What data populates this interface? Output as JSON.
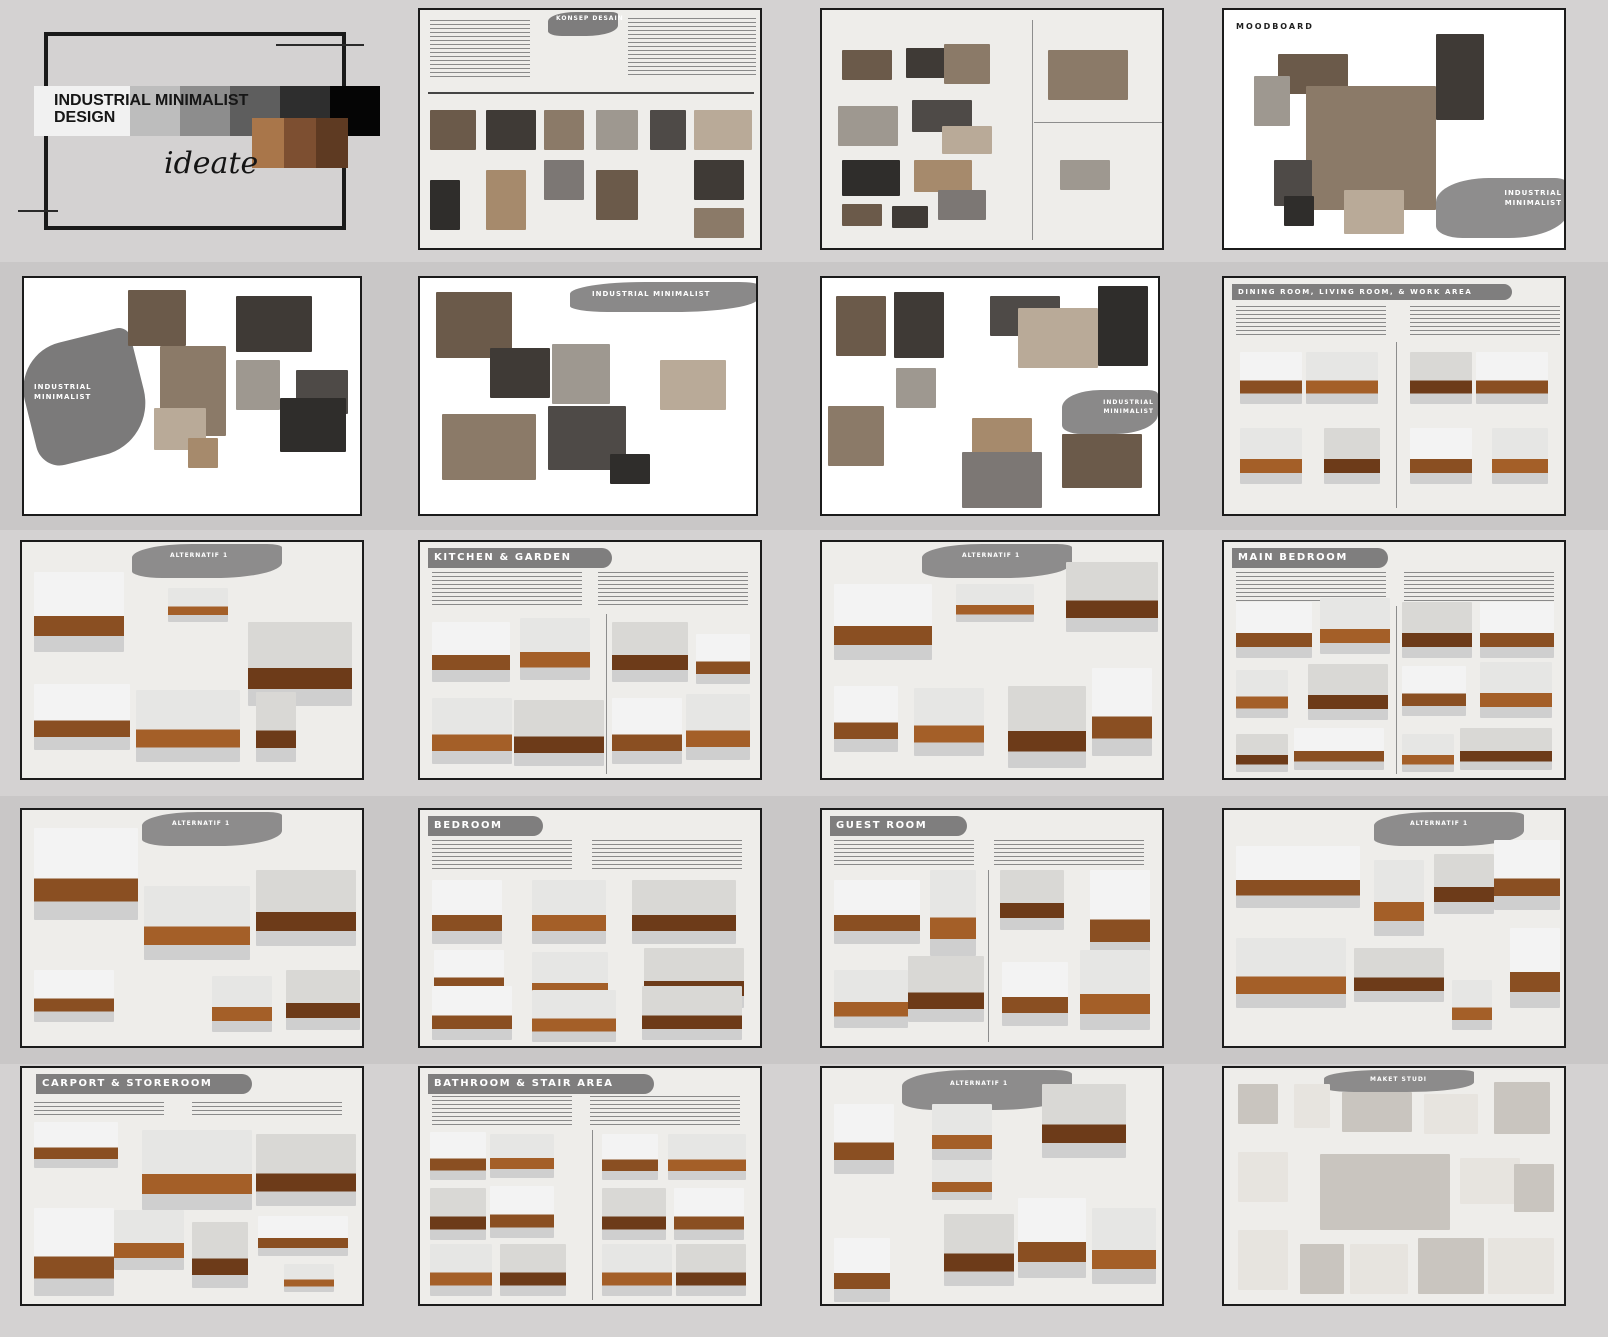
{
  "cover": {
    "title_line1": "INDUSTRIAL MINIMALIST",
    "title_line2": "DESIGN",
    "script_word": "ideate",
    "swatch_colors": [
      "#f1f1f1",
      "#bdbdbd",
      "#8d8d8d",
      "#5e5e5e",
      "#2e2e2e",
      "#050505"
    ],
    "wood_colors": [
      "#a9764a",
      "#7d4f31",
      "#5e3a22"
    ]
  },
  "slides": [
    {
      "id": "concept",
      "text": "KONSEP DESAIN"
    },
    {
      "id": "references",
      "text": ""
    },
    {
      "id": "moodboard",
      "text": "MOODBOARD",
      "label": "INDUSTRIAL MINIMALIST"
    },
    {
      "id": "im-board-1",
      "label": "INDUSTRIAL MINIMALIST"
    },
    {
      "id": "im-board-2",
      "label": "INDUSTRIAL MINIMALIST"
    },
    {
      "id": "im-board-3",
      "label": "INDUSTRIAL MINIMALIST"
    },
    {
      "id": "dining",
      "header": "DINING ROOM, LIVING ROOM, & WORK AREA"
    },
    {
      "id": "alt-living",
      "text": "ALTERNATIF 1"
    },
    {
      "id": "kitchen",
      "header": "KITCHEN & GARDEN"
    },
    {
      "id": "alt-kitchen",
      "text": "ALTERNATIF 1"
    },
    {
      "id": "main-bedroom",
      "header": "MAIN BEDROOM"
    },
    {
      "id": "alt-bedroom",
      "text": "ALTERNATIF 1"
    },
    {
      "id": "bedroom",
      "header": "BEDROOM"
    },
    {
      "id": "guest",
      "header": "GUEST ROOM"
    },
    {
      "id": "alt-guest",
      "text": "ALTERNATIF 1"
    },
    {
      "id": "carport",
      "header": "CARPORT & STOREROOM"
    },
    {
      "id": "bathroom",
      "header": "BATHROOM & STAIR AREA"
    },
    {
      "id": "alt-stair",
      "text": "ALTERNATIF 1"
    },
    {
      "id": "maket",
      "text": "MAKET STUDI"
    }
  ]
}
